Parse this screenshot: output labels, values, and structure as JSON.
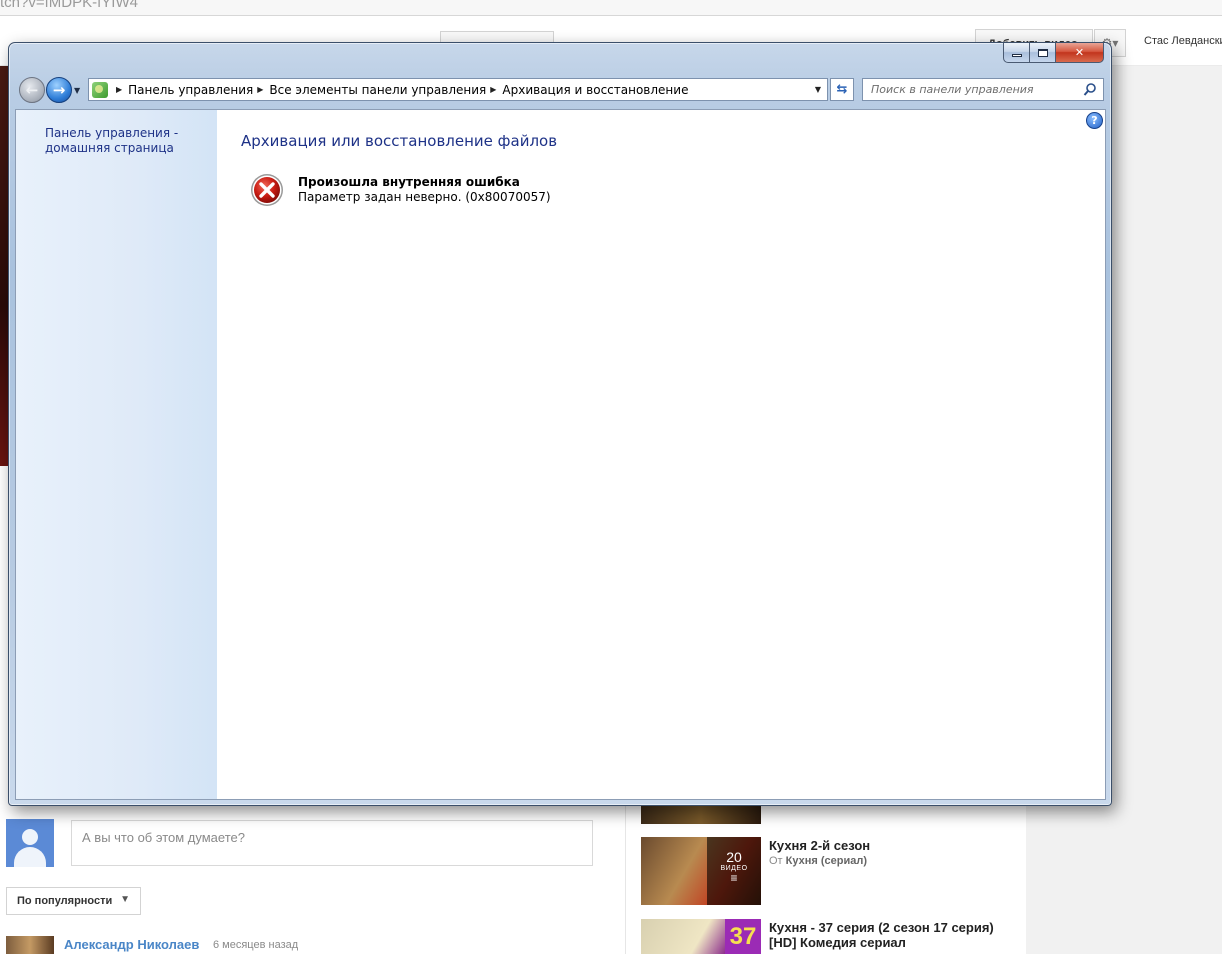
{
  "browser": {
    "url_fragment": "tch?v=fMDPK-fYIW4",
    "upload_label": "Добавить видео",
    "user_name": "Стас Левданский",
    "comment_placeholder": "А вы что об этом думаете?",
    "sort_label": "По популярности",
    "comment_author": "Александр Николаев",
    "comment_time": "6 месяцев назад",
    "videos": [
      {
        "title": "Кухня 2-й сезон",
        "by_prefix": "От",
        "channel": "Кухня (сериал)",
        "playlist_count": "20",
        "playlist_label": "ВИДЕО"
      },
      {
        "title": "Кухня - 37 серия (2 сезон 17 серия) [HD] Комедия сериал",
        "badge": "37"
      }
    ]
  },
  "window": {
    "breadcrumbs": [
      "Панель управления",
      "Все элементы панели управления",
      "Архивация и восстановление"
    ],
    "search_placeholder": "Поиск в панели управления",
    "sidebar_link": "Панель управления - домашняя страница",
    "page_title": "Архивация или восстановление файлов",
    "error_title": "Произошла внутренняя ошибка",
    "error_message": "Параметр задан неверно. (0x80070057)",
    "help_glyph": "?"
  },
  "icons": {
    "back": "back-arrow-icon",
    "forward": "forward-arrow-icon",
    "refresh": "refresh-icon",
    "search": "search-icon",
    "error": "error-x-icon",
    "help": "help-icon"
  },
  "colors": {
    "link_blue": "#1e3287",
    "close_red": "#c2341d",
    "frame_blue": "#b9cde4",
    "youtube_link": "#4a86c7"
  }
}
